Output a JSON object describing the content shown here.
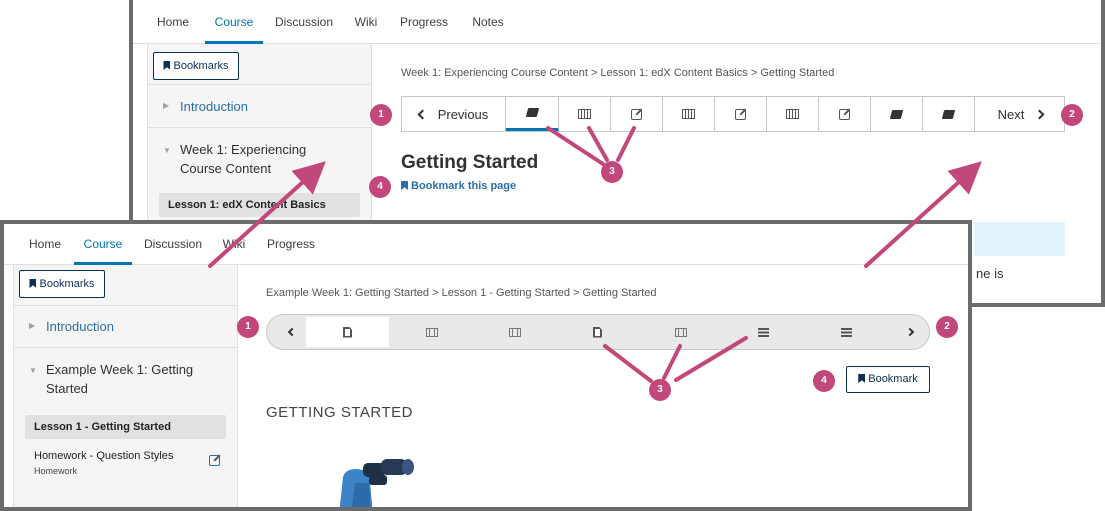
{
  "back": {
    "tabs": [
      "Home",
      "Course",
      "Discussion",
      "Wiki",
      "Progress",
      "Notes"
    ],
    "bookmarks_label": "Bookmarks",
    "sidebar": {
      "intro": "Introduction",
      "week_title": "Week 1: Experiencing Course Content",
      "lesson": "Lesson 1: edX Content Basics"
    },
    "breadcrumb": "Week 1: Experiencing Course Content > Lesson 1: edX Content Basics > Getting Started",
    "prev_label": "Previous",
    "next_label": "Next",
    "page_title": "Getting Started",
    "bookmark_page": "Bookmark this page",
    "partial_text": "ne is"
  },
  "front": {
    "tabs": [
      "Home",
      "Course",
      "Discussion",
      "Wiki",
      "Progress"
    ],
    "bookmarks_label": "Bookmarks",
    "sidebar": {
      "intro": "Introduction",
      "week_title": "Example Week 1: Getting Started",
      "lesson": "Lesson 1 - Getting Started",
      "homework_title": "Homework - Question Styles",
      "homework_type": "Homework"
    },
    "breadcrumb": "Example Week 1: Getting Started > Lesson 1 - Getting Started > Getting Started",
    "page_title": "GETTING STARTED",
    "bookmark_label": "Bookmark"
  },
  "callouts": [
    "1",
    "2",
    "3",
    "4"
  ],
  "colors": {
    "accent": "#0075b4",
    "callout": "#c2477b",
    "frame": "#6b6b6b",
    "link": "#2a6fa8"
  }
}
